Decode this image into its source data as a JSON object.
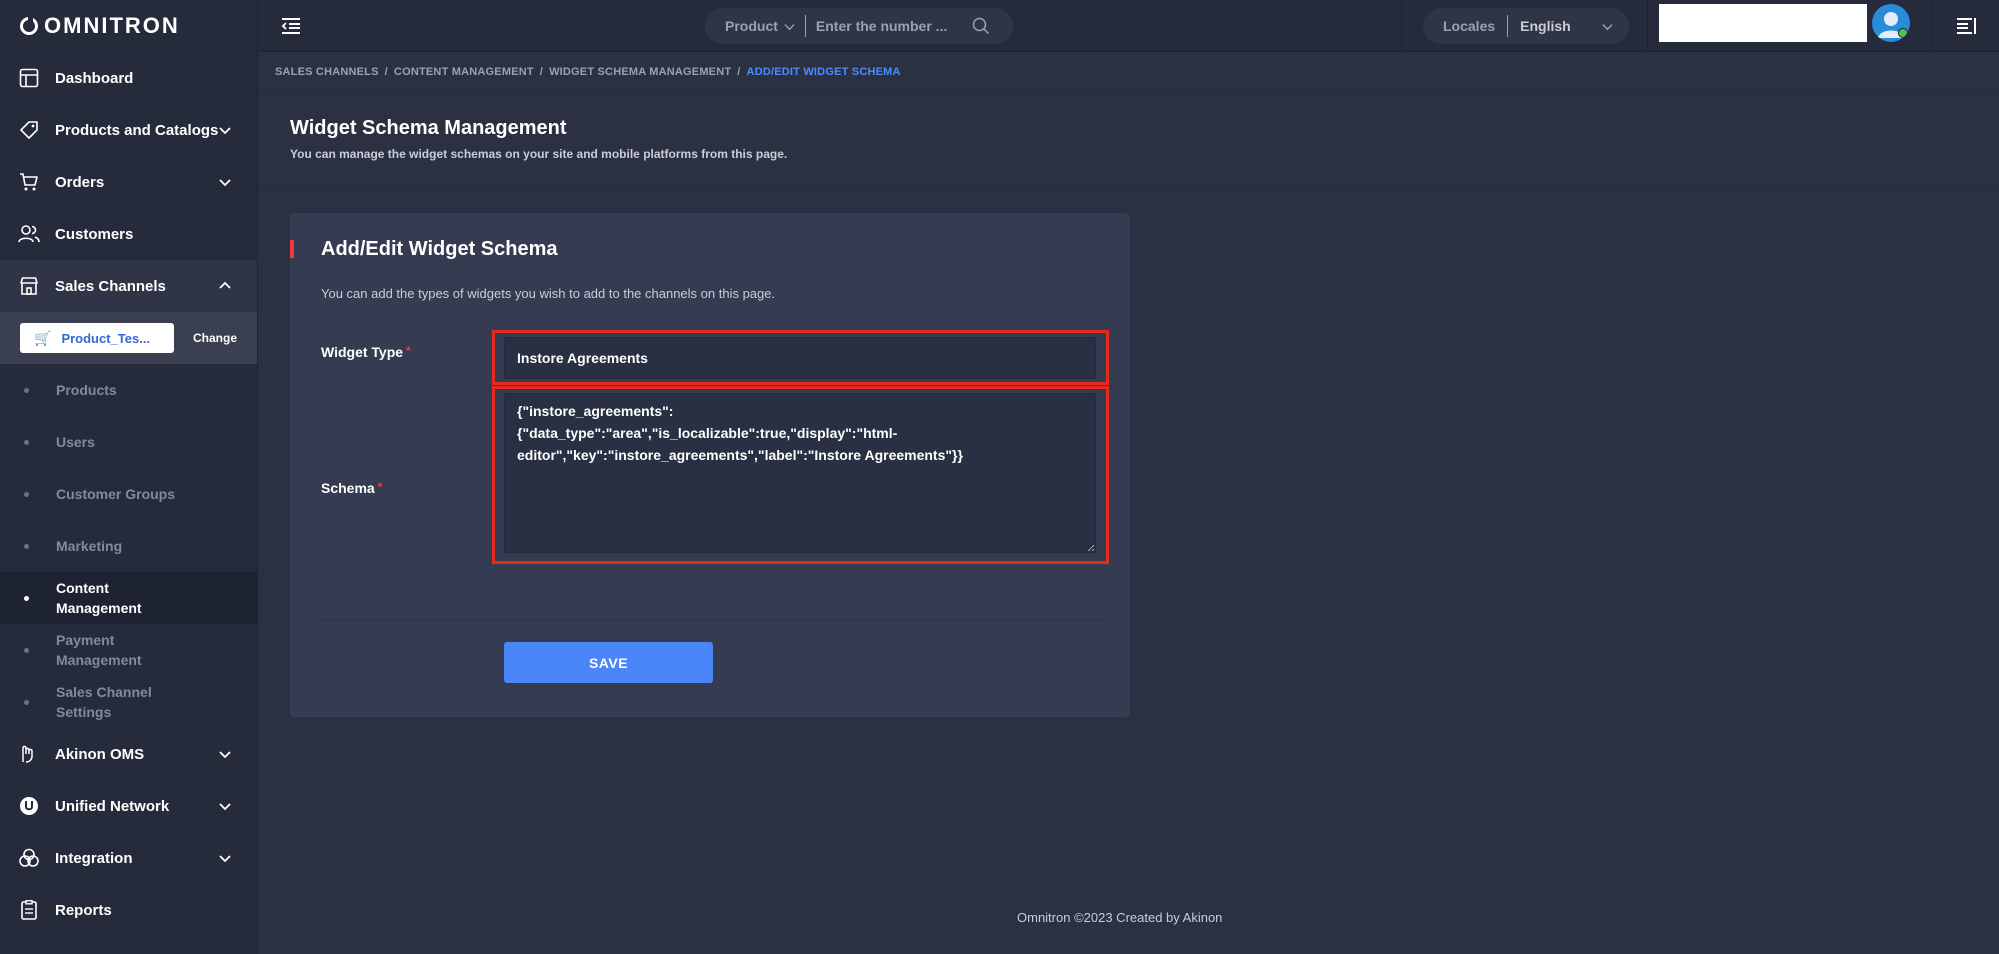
{
  "brand": {
    "logo_text": "OMNITRON"
  },
  "sidebar": {
    "items": [
      {
        "label": "Dashboard",
        "icon": "dashboard-icon"
      },
      {
        "label": "Products and Catalogs",
        "icon": "tag-icon"
      },
      {
        "label": "Orders",
        "icon": "cart-icon"
      },
      {
        "label": "Customers",
        "icon": "users-icon"
      },
      {
        "label": "Sales Channels",
        "icon": "store-icon"
      },
      {
        "label": "Akinon OMS",
        "icon": "oms-icon"
      },
      {
        "label": "Unified Network",
        "icon": "network-icon"
      },
      {
        "label": "Integration",
        "icon": "integration-icon"
      },
      {
        "label": "Reports",
        "icon": "reports-icon"
      }
    ],
    "channel": {
      "name": "Product_Tes...",
      "change_label": "Change"
    },
    "sub_items": [
      {
        "line1": "Products",
        "line2": ""
      },
      {
        "line1": "Users",
        "line2": ""
      },
      {
        "line1": "Customer Groups",
        "line2": ""
      },
      {
        "line1": "Marketing",
        "line2": ""
      },
      {
        "line1": "Content",
        "line2": "Management"
      },
      {
        "line1": "Payment",
        "line2": "Management"
      },
      {
        "line1": "Sales Channel",
        "line2": "Settings"
      }
    ]
  },
  "topbar": {
    "search_scope": "Product",
    "search_placeholder": "Enter the number ...",
    "locales_label": "Locales",
    "locale_value": "English"
  },
  "breadcrumb": {
    "items": [
      "SALES CHANNELS",
      "/",
      "CONTENT MANAGEMENT",
      "/",
      "WIDGET SCHEMA MANAGEMENT",
      "/"
    ],
    "active": "ADD/EDIT WIDGET SCHEMA"
  },
  "page": {
    "title": "Widget Schema Management",
    "description": "You can manage the widget schemas on your site and mobile platforms from this page."
  },
  "card": {
    "title": "Add/Edit Widget Schema",
    "description": "You can add the types of widgets you wish to add to the channels on this page.",
    "widget_type_label": "Widget Type",
    "widget_type_value": "Instore Agreements",
    "schema_label": "Schema",
    "schema_value": "{\"instore_agreements\":\n{\"data_type\":\"area\",\"is_localizable\":true,\"display\":\"html-\neditor\",\"key\":\"instore_agreements\",\"label\":\"Instore Agreements\"}}",
    "required_mark": "*",
    "save_label": "SAVE"
  },
  "footer": {
    "text": "Omnitron ©2023 Created by Akinon"
  },
  "colors": {
    "background": "#2b3142",
    "sidebar": "#252b3b",
    "card": "#353c51",
    "accent_blue": "#4a86f7",
    "accent_red": "#ef3a46",
    "highlight_red": "#e32b1e"
  }
}
